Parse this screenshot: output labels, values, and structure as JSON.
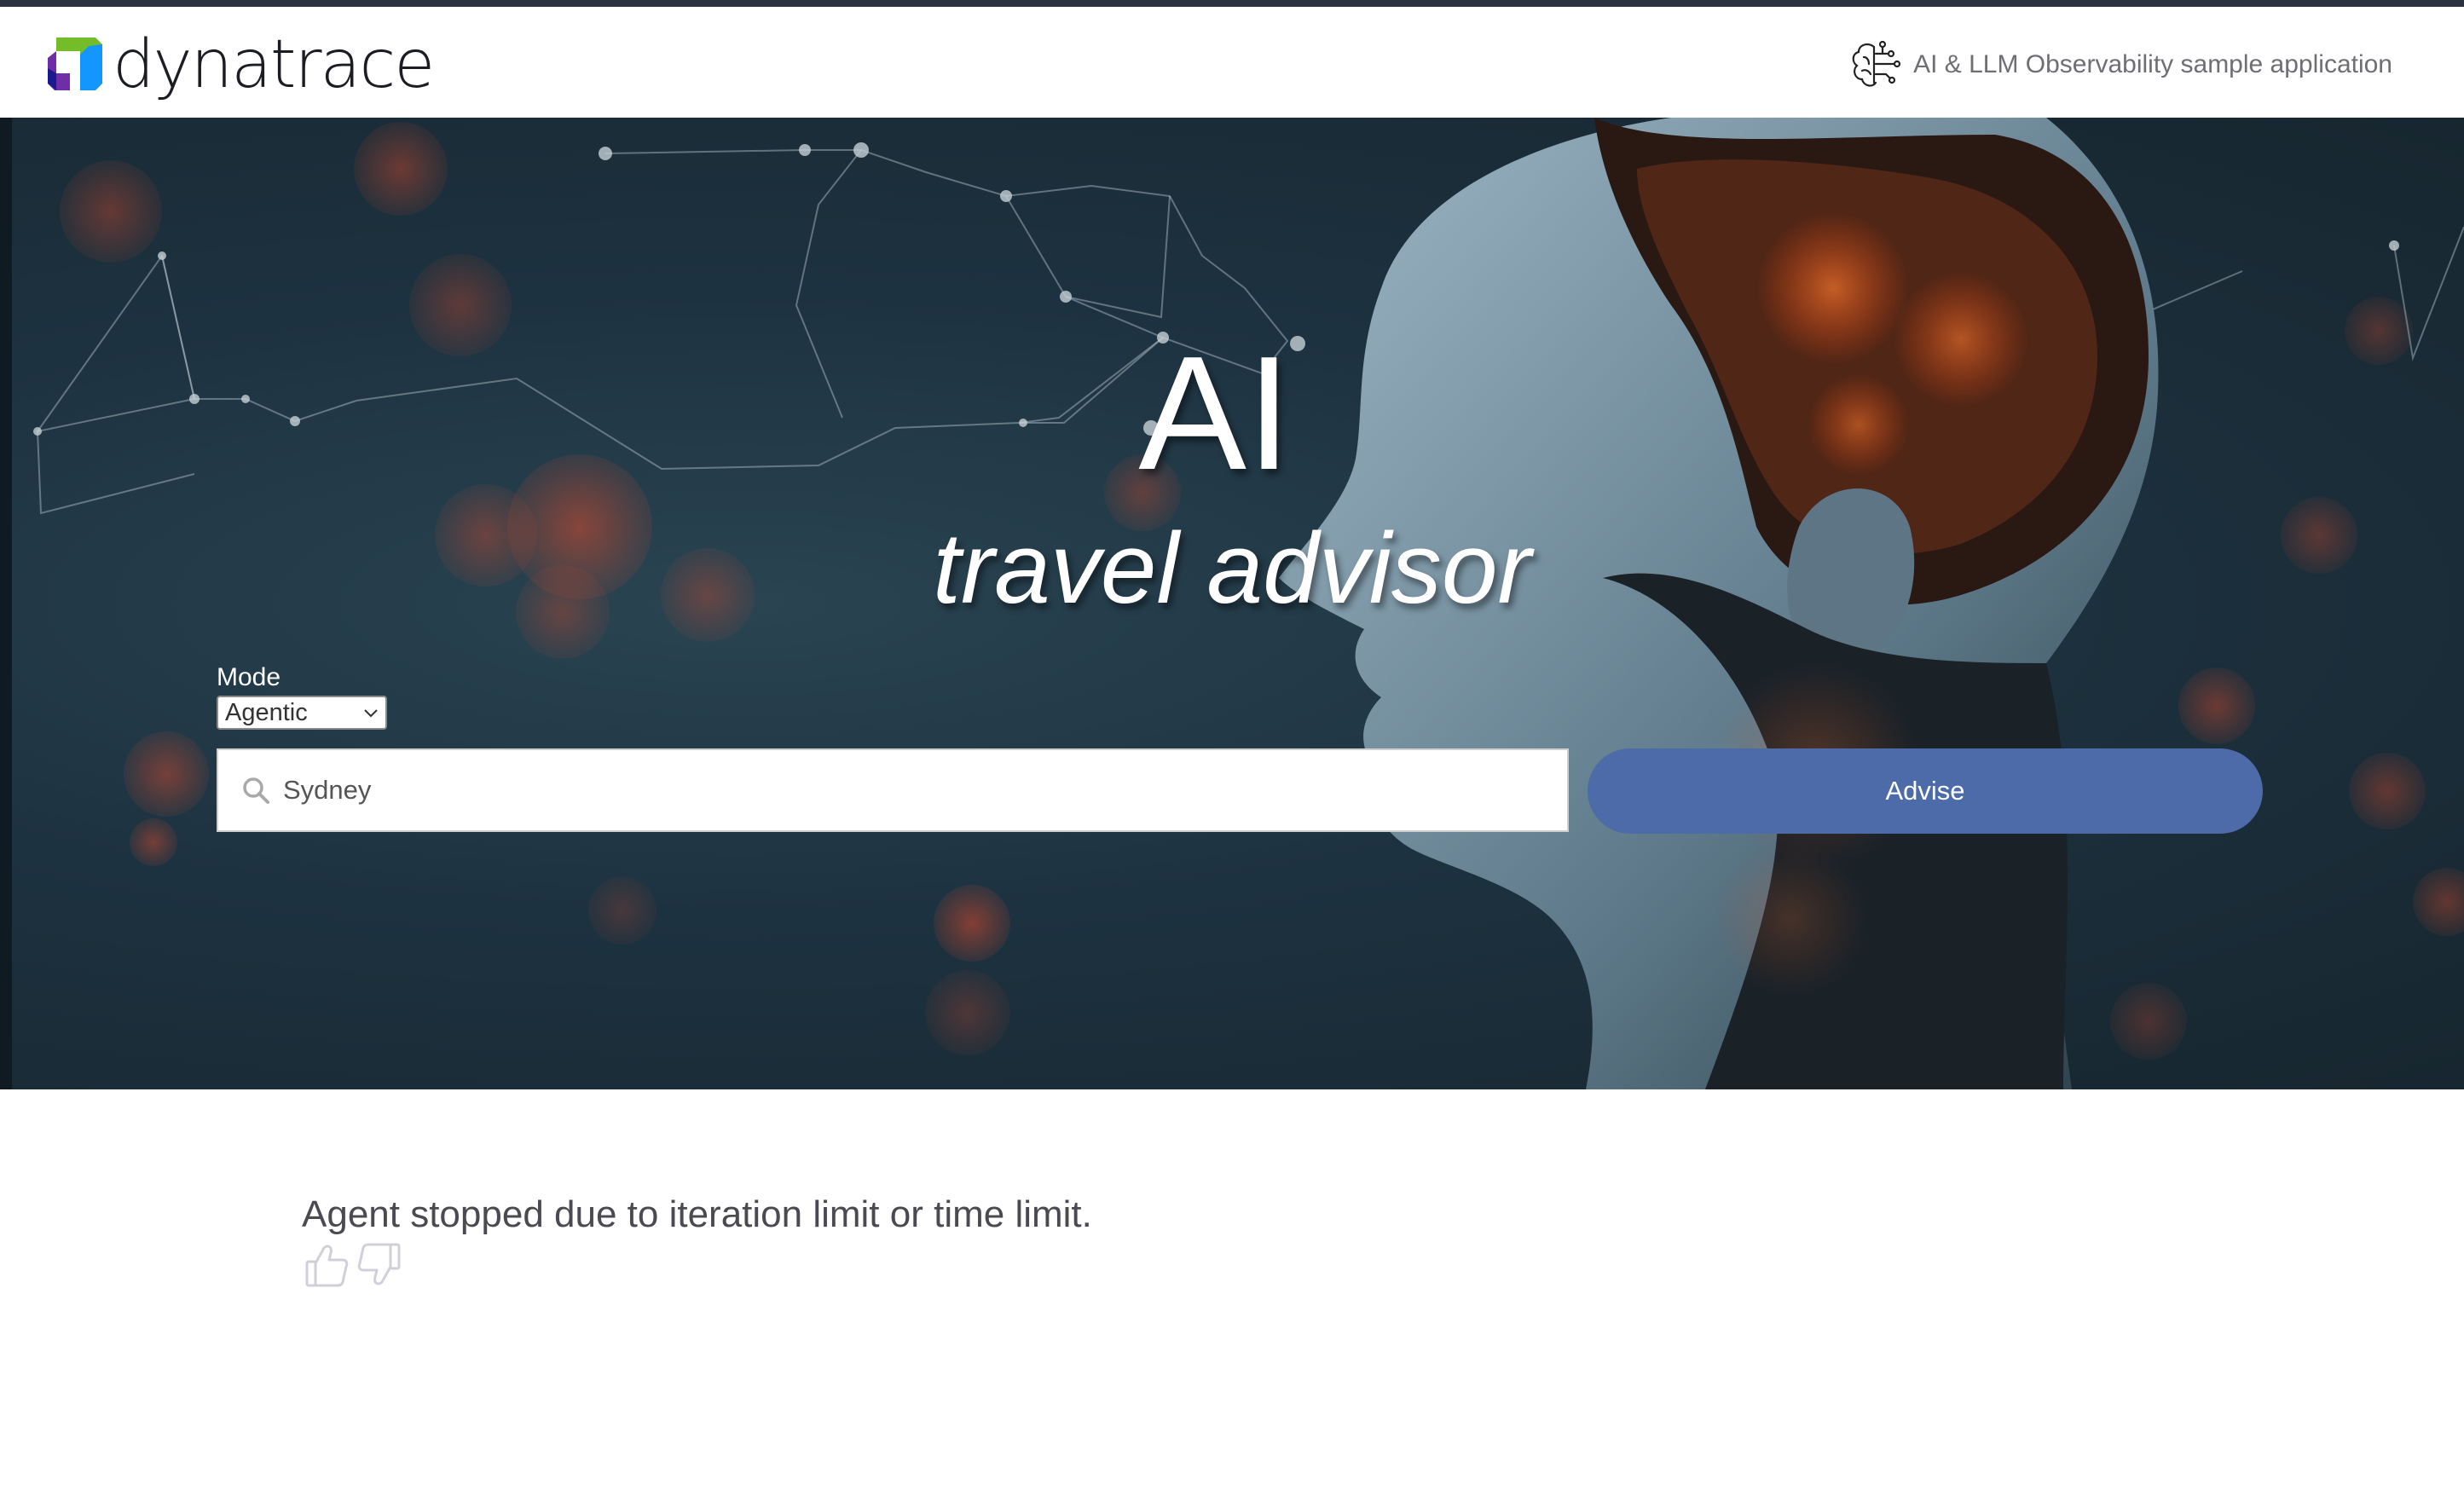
{
  "header": {
    "logo_text": "dynatrace",
    "app_label": "AI & LLM Observability sample application",
    "icons": [
      "dynatrace-logo-mark",
      "brain-circuit-icon"
    ]
  },
  "hero": {
    "title": "AI",
    "subtitle": "travel advisor"
  },
  "form": {
    "mode_label": "Mode",
    "mode_value": "Agentic",
    "search_value": "Sydney",
    "advise_label": "Advise"
  },
  "result": {
    "message": "Agent stopped due to iteration limit or time limit.",
    "feedback_icons": [
      "thumbs-up-icon",
      "thumbs-down-icon"
    ]
  },
  "colors": {
    "accent": "#4d6ba8",
    "hero_bg": "#1d3240",
    "text": "#4a4a50"
  }
}
